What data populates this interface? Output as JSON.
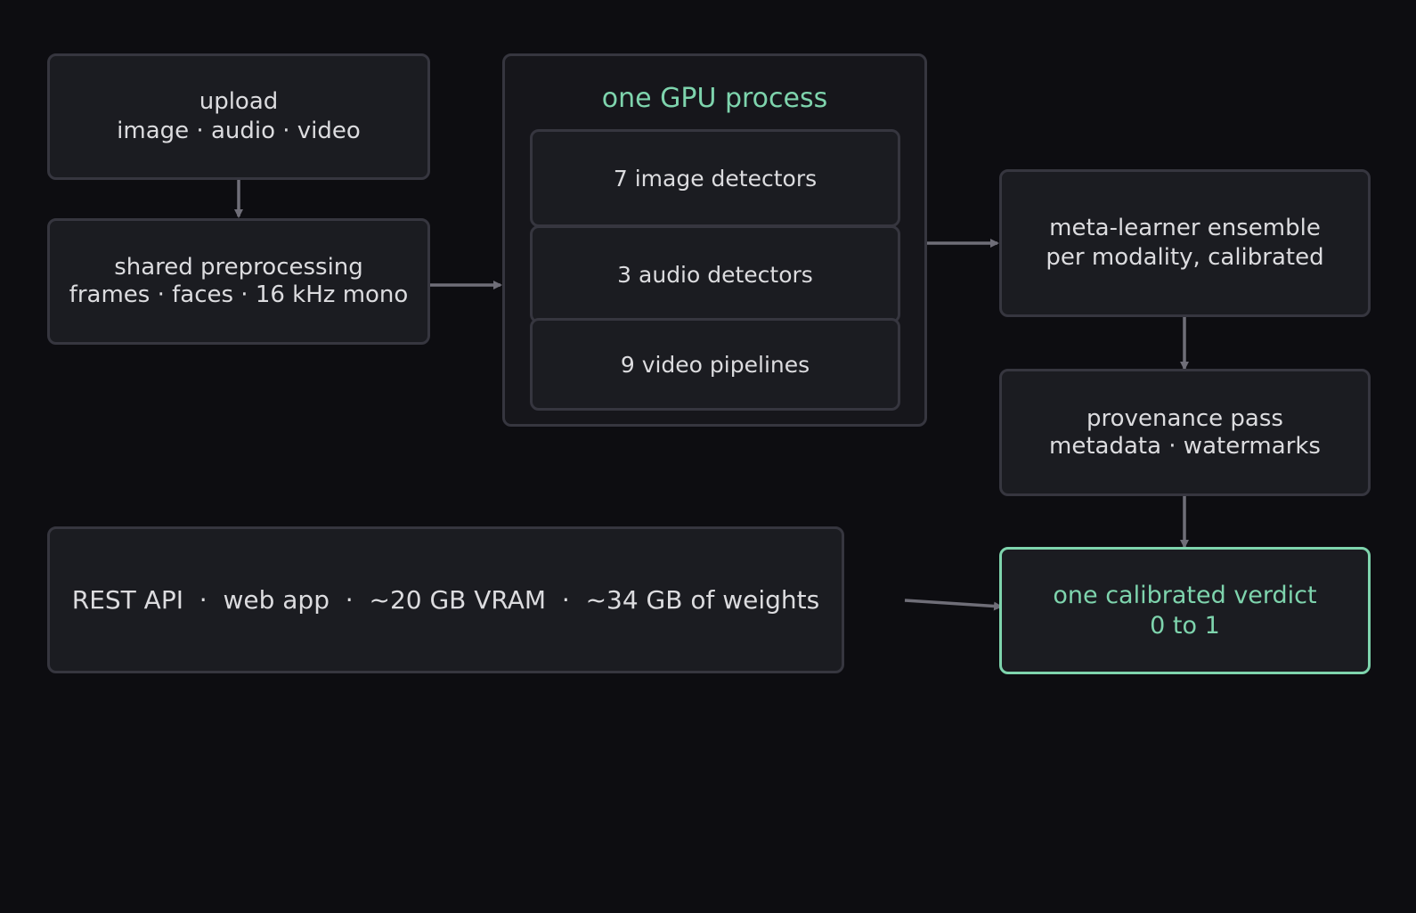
{
  "upload": {
    "line1": "upload",
    "line2": "image · audio · video"
  },
  "preprocessing": {
    "line1": "shared preprocessing",
    "line2": "frames · faces · 16 kHz mono"
  },
  "gpu_process": {
    "title": "one GPU process",
    "detectors": [
      {
        "label": "7 image detectors"
      },
      {
        "label": "3 audio detectors"
      },
      {
        "label": "9 video pipelines"
      }
    ]
  },
  "meta_learner": {
    "line1": "meta-learner ensemble",
    "line2": "per modality, calibrated"
  },
  "provenance": {
    "line1": "provenance pass",
    "line2": "metadata · watermarks"
  },
  "verdict": {
    "line1": "one calibrated verdict",
    "line2": "0 to 1"
  },
  "deployment": {
    "label": "REST API  ·  web app  ·  ~20 GB VRAM  ·  ~34 GB of weights"
  },
  "colors": {
    "background": "#0d0d11",
    "box_fill": "#1b1c21",
    "box_border": "#36363f",
    "accent": "#7ed4ad",
    "text": "#dcdcdf",
    "arrow": "#6f6e78"
  }
}
